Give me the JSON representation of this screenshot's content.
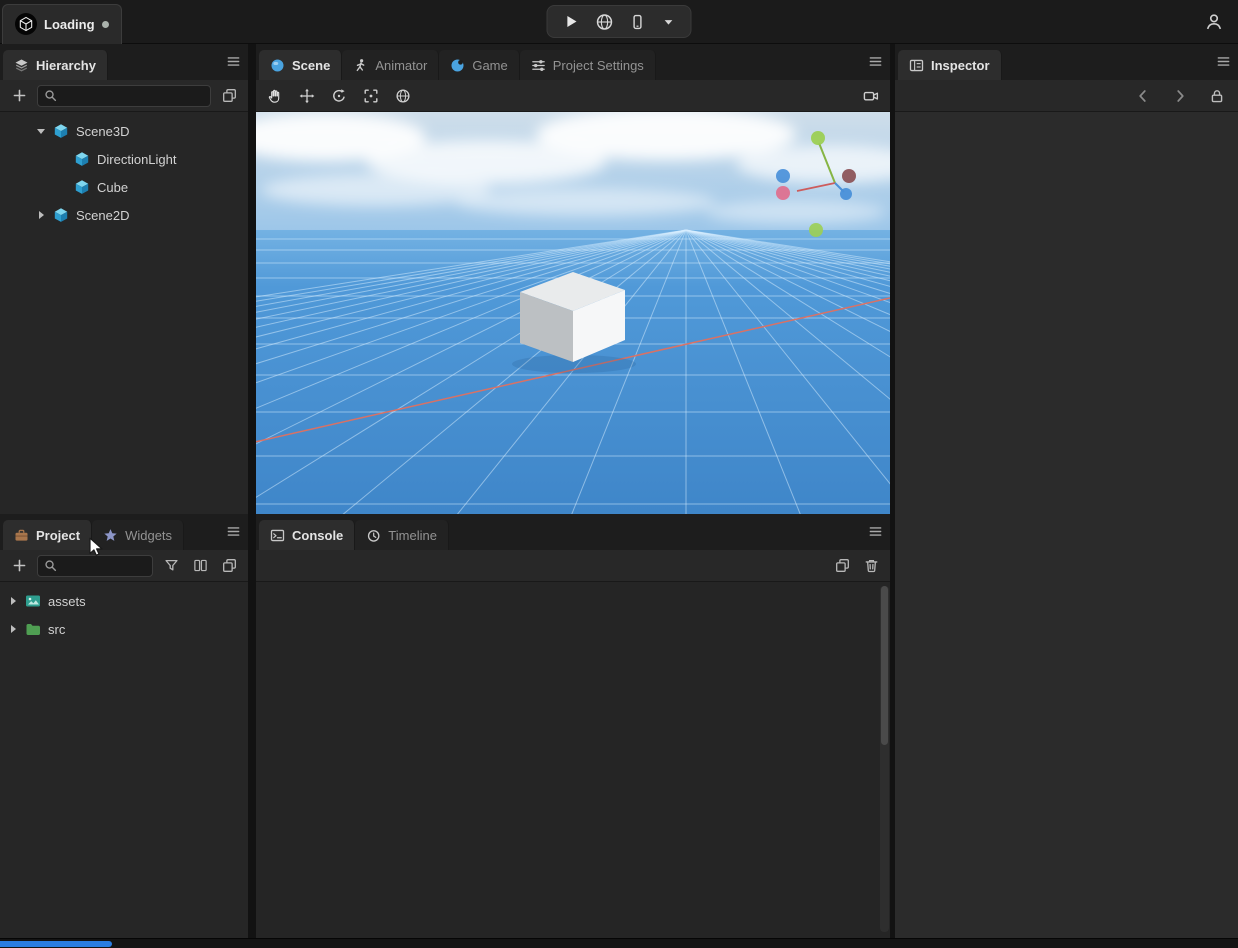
{
  "topbar": {
    "project_name": "Loading",
    "modified_indicator": true
  },
  "hierarchy_panel": {
    "tab_label": "Hierarchy",
    "search": {
      "value": "",
      "placeholder": ""
    },
    "tree": [
      {
        "label": "Scene3D",
        "depth": 0,
        "expanded": true,
        "icon": "cube-3d"
      },
      {
        "label": "DirectionLight",
        "depth": 1,
        "icon": "cube-3d"
      },
      {
        "label": "Cube",
        "depth": 1,
        "icon": "cube-3d"
      },
      {
        "label": "Scene2D",
        "depth": 0,
        "expanded": false,
        "icon": "cube-3d"
      }
    ]
  },
  "project_panel": {
    "tabs": [
      {
        "label": "Project",
        "active": true,
        "icon": "briefcase"
      },
      {
        "label": "Widgets",
        "active": false,
        "icon": "star"
      }
    ],
    "search": {
      "value": "",
      "placeholder": ""
    },
    "tree": [
      {
        "label": "assets",
        "expanded": false,
        "icon": "image-folder"
      },
      {
        "label": "src",
        "expanded": false,
        "icon": "folder"
      }
    ]
  },
  "scene_panel": {
    "tabs": [
      {
        "label": "Scene",
        "active": true,
        "icon": "sphere"
      },
      {
        "label": "Animator",
        "active": false,
        "icon": "running-figure"
      },
      {
        "label": "Game",
        "active": false,
        "icon": "circle-logo"
      },
      {
        "label": "Project Settings",
        "active": false,
        "icon": "sliders"
      }
    ],
    "viewport": {
      "objects": [
        "grid-floor",
        "white-cube",
        "x-axis-red-line",
        "orientation-gizmo",
        "cloudy-sky"
      ],
      "gizmo_axes": [
        "Y-green-up",
        "X-red",
        "Z-blue"
      ]
    }
  },
  "console_panel": {
    "tabs": [
      {
        "label": "Console",
        "active": true,
        "icon": "terminal"
      },
      {
        "label": "Timeline",
        "active": false,
        "icon": "clock"
      }
    ],
    "messages": []
  },
  "inspector_panel": {
    "tab_label": "Inspector",
    "content_empty": true
  },
  "icons": {
    "app-logo": "hex-cube",
    "play": "triangle-right",
    "preview-web": "globe",
    "preview-device": "smartphone",
    "play-options": "caret-down",
    "user-avatar": "person-outline",
    "panel-menu": "hamburger",
    "add": "plus",
    "search": "magnifier",
    "duplicate": "copy-squares",
    "filter": "funnel",
    "split-view": "columns",
    "clear": "trash",
    "pan-tool": "hand",
    "move-tool": "arrows-cross",
    "rotate-tool": "circular-arrow",
    "frame-tool": "corner-brackets",
    "gizmo-tool": "wire-globe",
    "camera-preview": "video-camera",
    "back": "chevron-left",
    "forward": "chevron-right",
    "lock": "padlock"
  },
  "colors": {
    "topbar_bg": "#1b1b1b",
    "strip_bg": "#1d1d1d",
    "active_tab_bg": "#2d2d2d",
    "panel_bg": "#262626",
    "console_bg": "#252525",
    "inspector_bg": "#2b2b2b",
    "accent_blue": "#4aa3e0",
    "node_icon_teal": "#2e9fd0",
    "assets_icon_teal": "#2e9e8f",
    "src_icon_green": "#4f9e52",
    "axis_red": "#e2705f",
    "gizmo_green": "#9ccf54",
    "gizmo_blue": "#4a90d9",
    "gizmo_pink": "#df6e8d",
    "sky_blue": "#9cc6e9",
    "ground_blue": "#4a94d4",
    "progress_blue": "#2a7de1"
  }
}
